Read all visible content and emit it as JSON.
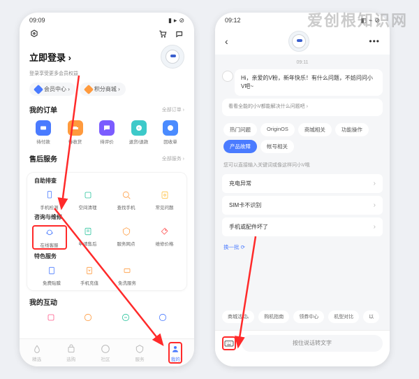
{
  "watermark": "爱创根知识网",
  "leftPhone": {
    "time": "09:09",
    "login": {
      "title": "立即登录 ›",
      "sub": "登录享受更多会员权益"
    },
    "chips": [
      "会员中心 ›",
      "积分商城 ›"
    ],
    "orders": {
      "title": "我的订单",
      "more": "全部订单 ›",
      "items": [
        "待付款",
        "待收货",
        "待评价",
        "退货/退款",
        "回收单"
      ]
    },
    "after": {
      "title": "售后服务",
      "more": "全部服务 ›"
    },
    "self": {
      "title": "自助排查",
      "items": [
        "手机检测",
        "空间清理",
        "查找手机",
        "常见问题"
      ]
    },
    "consult": {
      "title": "咨询与维修",
      "items": [
        "在线客服",
        "申请售后",
        "服务网点",
        "维修价格"
      ]
    },
    "special": {
      "title": "特色服务",
      "items": [
        "免费贴膜",
        "手机充值",
        "免洗服务"
      ]
    },
    "interact": {
      "title": "我的互动"
    },
    "tabs": [
      "精选",
      "选购",
      "社区",
      "服务",
      "我的"
    ]
  },
  "rightPhone": {
    "time": "09:12",
    "chatTime": "09:11",
    "greeting": "Hi，亲爱的V粉，新年快乐！有什么问题，不妨问问小V吧~",
    "helper": "看看全能的小V都能解决什么问题吧 ›",
    "tags": [
      "热门问题",
      "OriginOS",
      "商城相关",
      "功能操作",
      "产品故障",
      "帐号相关"
    ],
    "activeTag": 4,
    "hint": "您可以直接输入关键词或像这样问小V哦",
    "questions": [
      "充电异常",
      "SIM卡不识别",
      "手机或配件坏了"
    ],
    "refresh": "换一批 ⟳",
    "scrollChips": [
      "商城活动ᵥ",
      "购机指南",
      "领券中心",
      "机型对比",
      "以"
    ],
    "voiceBtn": "按住说话转文字"
  }
}
